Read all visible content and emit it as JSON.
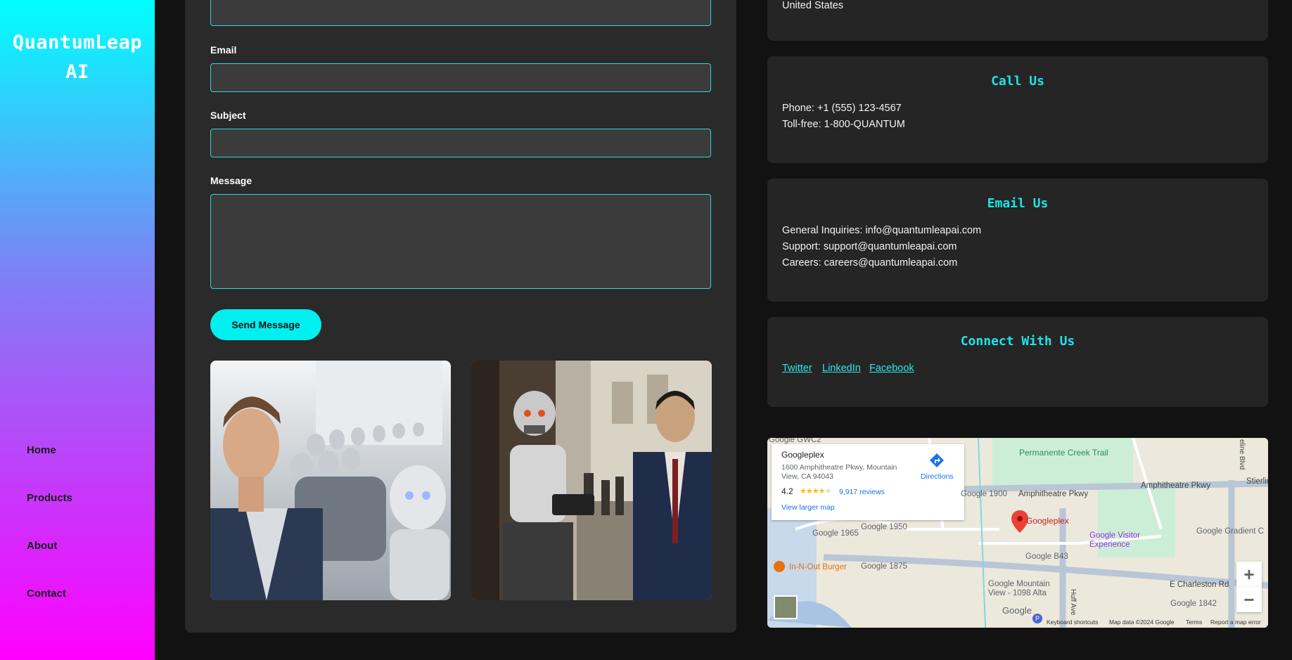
{
  "brand": {
    "name": "QuantumLeap AI"
  },
  "nav": {
    "items": [
      {
        "label": "Home"
      },
      {
        "label": "Products"
      },
      {
        "label": "About"
      },
      {
        "label": "Contact"
      }
    ]
  },
  "form": {
    "email_label": "Email",
    "subject_label": "Subject",
    "message_label": "Message",
    "send_label": "Send Message"
  },
  "location": {
    "country": "United States"
  },
  "call": {
    "title": "Call Us",
    "phone": "Phone: +1 (555) 123-4567",
    "tollfree": "Toll-free: 1-800-QUANTUM"
  },
  "email_us": {
    "title": "Email Us",
    "general": "General Inquiries: info@quantumleapai.com",
    "support": "Support: support@quantumleapai.com",
    "careers": "Careers: careers@quantumleapai.com"
  },
  "connect": {
    "title": "Connect With Us",
    "links": [
      "Twitter",
      "LinkedIn",
      "Facebook"
    ]
  },
  "map": {
    "place_name": "Googleplex",
    "address": "1600 Amphitheatre Pkwy, Mountain View, CA 94043",
    "rating": "4.2",
    "rating_value": 4.2,
    "reviews": "9,917 reviews",
    "directions": "Directions",
    "larger_map": "View larger map",
    "labels": {
      "gwc2": "Google GWC2",
      "trail": "Permanente Creek Trail",
      "g1900": "Google 1900",
      "amph1": "Amphitheatre Pkwy",
      "amph2": "Amphitheatre Pkwy",
      "stierlin": "Stierlin",
      "googleplex_pin": "Googleplex",
      "g1950": "Google 1950",
      "g1965": "Google 1965",
      "visitor": "Google Visitor Experience",
      "gradient": "Google Gradient C",
      "b43": "Google B43",
      "innout": "In-N-Out Burger",
      "g1875": "Google 1875",
      "mountain": "Google Mountain View - 1098 Alta",
      "charleston": "E Charleston Rd",
      "g1842": "Google 1842",
      "huff": "Huff Ave",
      "shoreline": "eline Blvd"
    },
    "zoom_in": "+",
    "zoom_out": "−",
    "logo": "Google",
    "shortcuts": "Keyboard shortcuts",
    "map_data": "Map data ©2024 Google",
    "terms": "Terms",
    "report": "Report a map error"
  },
  "colors": {
    "accent": "#00f0f0",
    "panel": "#2a2a2a",
    "card": "#252525",
    "page": "#121212"
  },
  "icons": {
    "directions": "directions-icon",
    "pin": "map-pin-icon",
    "restaurant": "restaurant-icon"
  }
}
